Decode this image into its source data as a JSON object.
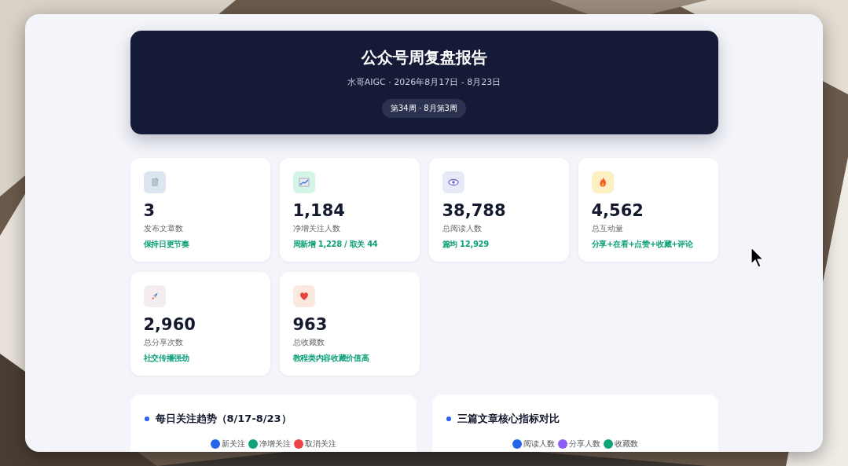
{
  "header": {
    "title": "公众号周复盘报告",
    "subtitle": "水哥AIGC · 2026年8月17日 - 8月23日",
    "badge": "第34周 · 8月第3周"
  },
  "stats": [
    {
      "value": "3",
      "label": "发布文章数",
      "note": "保持日更节奏"
    },
    {
      "value": "1,184",
      "label": "净增关注人数",
      "note": "周新增 1,228 / 取关 44"
    },
    {
      "value": "38,788",
      "label": "总阅读人数",
      "note": "篇均 12,929"
    },
    {
      "value": "4,562",
      "label": "总互动量",
      "note": "分享+在看+点赞+收藏+评论"
    },
    {
      "value": "2,960",
      "label": "总分享次数",
      "note": "社交传播强劲"
    },
    {
      "value": "963",
      "label": "总收藏数",
      "note": "教程类内容收藏价值高"
    }
  ],
  "charts": [
    {
      "title": "每日关注趋势（8/17-8/23）",
      "legend": [
        {
          "label": "新关注",
          "color": "#2563eb"
        },
        {
          "label": "净增关注",
          "color": "#10a37a"
        },
        {
          "label": "取消关注",
          "color": "#ef4444"
        }
      ]
    },
    {
      "title": "三篇文章核心指标对比",
      "legend": [
        {
          "label": "阅读人数",
          "color": "#2563eb"
        },
        {
          "label": "分享人数",
          "color": "#8b5cf6"
        },
        {
          "label": "收藏数",
          "color": "#10a37a"
        }
      ]
    }
  ]
}
